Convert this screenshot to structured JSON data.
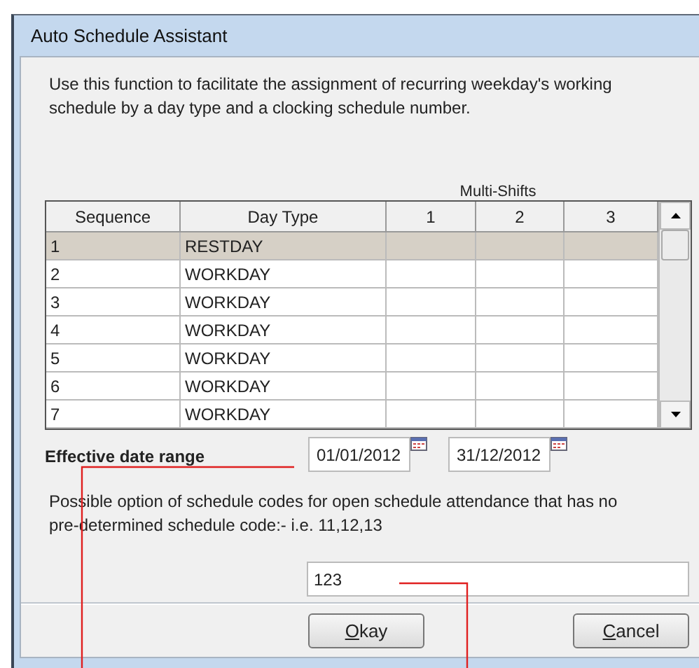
{
  "window": {
    "title": "Auto Schedule Assistant"
  },
  "description": "Use this function to facilitate the assignment of recurring weekday's working schedule by a day type and a clocking schedule number.",
  "table": {
    "group_heading": "Multi-Shifts",
    "columns": [
      "Sequence",
      "Day Type",
      "1",
      "2",
      "3"
    ],
    "rows": [
      {
        "sequence": "1",
        "day_type": "RESTDAY",
        "selected": true
      },
      {
        "sequence": "2",
        "day_type": "WORKDAY",
        "selected": false
      },
      {
        "sequence": "3",
        "day_type": "WORKDAY",
        "selected": false
      },
      {
        "sequence": "4",
        "day_type": "WORKDAY",
        "selected": false
      },
      {
        "sequence": "5",
        "day_type": "WORKDAY",
        "selected": false
      },
      {
        "sequence": "6",
        "day_type": "WORKDAY",
        "selected": false
      },
      {
        "sequence": "7",
        "day_type": "WORKDAY",
        "selected": false
      }
    ]
  },
  "date_range": {
    "label": "Effective date range",
    "from": "01/01/2012",
    "to": "31/12/2012"
  },
  "codes": {
    "note": "Possible option of schedule codes for open schedule attendance that has no pre-determined schedule code:-  i.e. 11,12,13",
    "value": "123"
  },
  "buttons": [
    {
      "label": "Okay"
    },
    {
      "label": "Cancel"
    }
  ]
}
